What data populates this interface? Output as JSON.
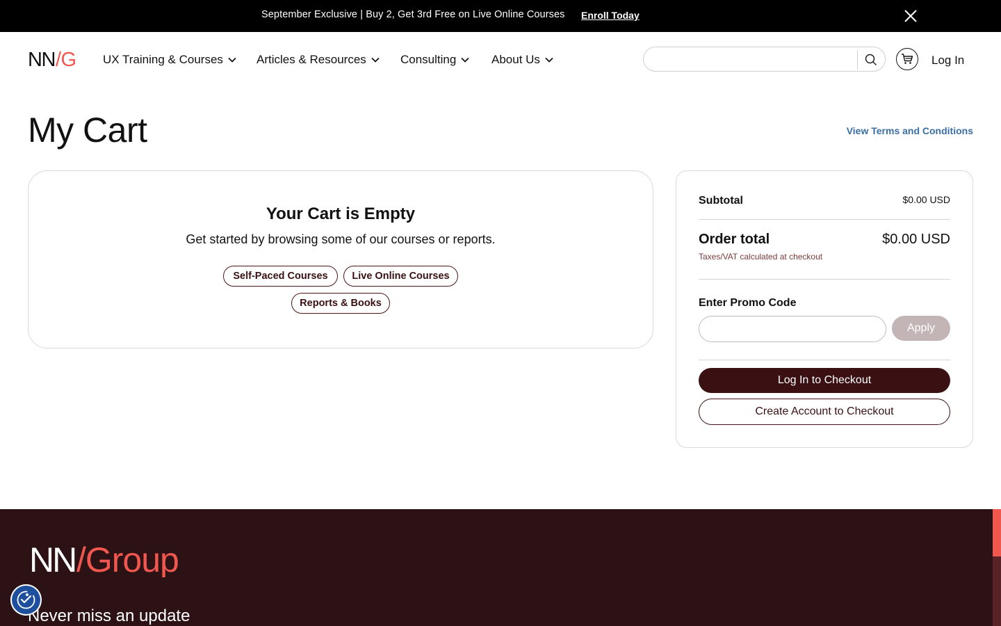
{
  "banner": {
    "text": "September Exclusive | Buy 2, Get 3rd Free on Live Online Courses",
    "link": "Enroll Today",
    "close_icon": "close-icon"
  },
  "header": {
    "logo_nn": "NN",
    "logo_slash_g": "/G",
    "nav": [
      {
        "label": "UX Training & Courses",
        "icon": "chevron-down-icon"
      },
      {
        "label": "Articles & Resources",
        "icon": "chevron-down-icon"
      },
      {
        "label": "Consulting",
        "icon": "chevron-down-icon"
      },
      {
        "label": "About Us",
        "icon": "chevron-down-icon"
      }
    ],
    "search": {
      "placeholder": "",
      "value": "",
      "icon": "search-icon"
    },
    "cart_icon": "cart-icon",
    "login": "Log In"
  },
  "page": {
    "title": "My Cart",
    "terms_link": "View Terms and Conditions"
  },
  "empty_cart": {
    "title": "Your Cart is Empty",
    "subtitle": "Get started by browsing some of our courses or reports.",
    "buttons": [
      "Self-Paced Courses",
      "Live Online Courses",
      "Reports & Books"
    ]
  },
  "summary": {
    "subtotal_label": "Subtotal",
    "subtotal_value": "$0.00 USD",
    "order_total_label": "Order total",
    "order_total_value": "$0.00 USD",
    "tax_note": "Taxes/VAT calculated at checkout",
    "promo_label": "Enter Promo Code",
    "promo_value": "",
    "apply": "Apply",
    "login_checkout": "Log In to Checkout",
    "create_account_checkout": "Create Account to Checkout"
  },
  "footer": {
    "logo_nn": "NN",
    "logo_group": "/Group",
    "heading": "Never miss an update"
  },
  "accessibility": {
    "icon": "accessibility-icon"
  },
  "colors": {
    "banner_bg": "#000000",
    "brand_red": "#f0574f",
    "brand_maroon": "#3a1012",
    "footer_bg": "#2c1215",
    "link_blue": "#3a6ea5",
    "a11y_blue": "#1e4f9c"
  }
}
